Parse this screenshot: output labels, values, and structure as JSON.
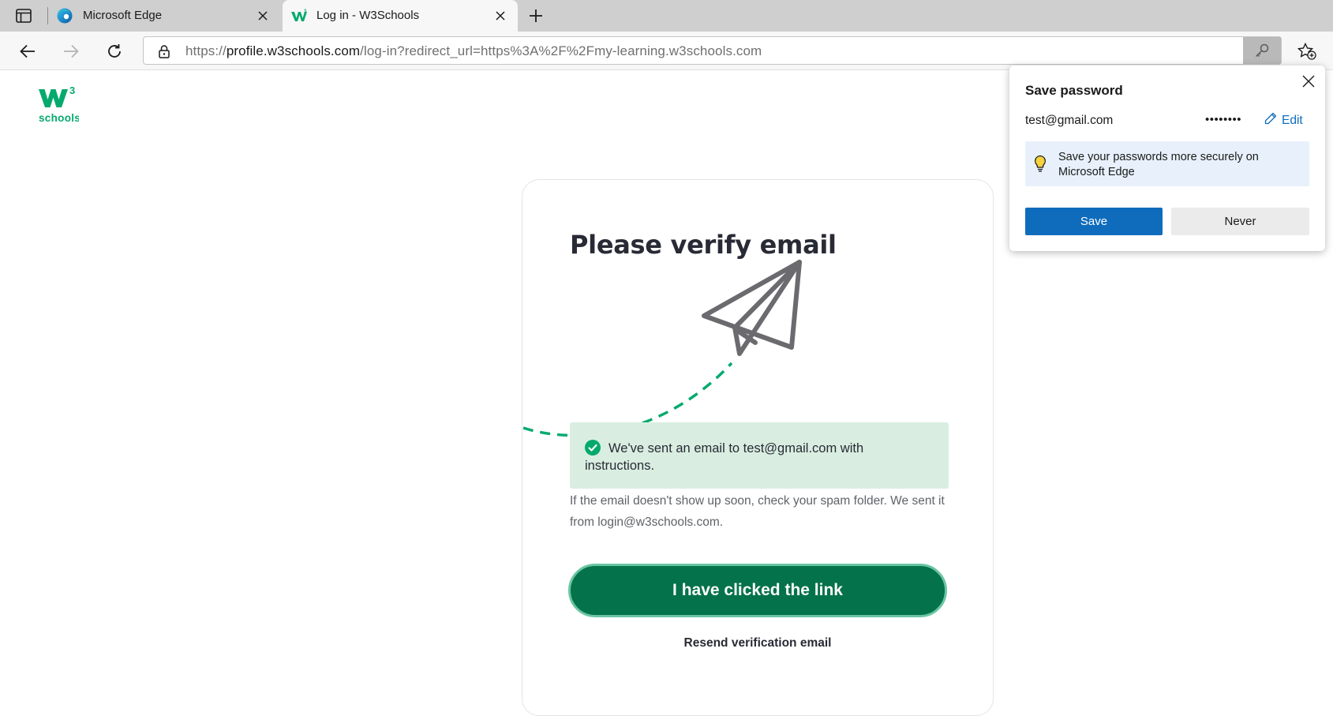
{
  "browser": {
    "tabs": [
      {
        "title": "Microsoft Edge",
        "icon": "edge-logo-icon",
        "active": false
      },
      {
        "title": "Log in - W3Schools",
        "icon": "w3schools-favicon-icon",
        "active": true
      }
    ],
    "url": {
      "scheme": "https://",
      "host": "profile.w3schools.com",
      "path": "/log-in?redirect_url=https%3A%2F%2Fmy-learning.w3schools.com"
    }
  },
  "page": {
    "logo": {
      "mark": "W",
      "superscript": "3",
      "wordmark": "schools"
    },
    "heading": "Please verify email",
    "alert_text": "We've sent an email to test@gmail.com with instructions.",
    "note": "If the email doesn't show up soon, check your spam folder. We sent it from login@w3schools.com.",
    "primary_button": "I have clicked the link",
    "resend_link": "Resend verification email",
    "colors": {
      "brand_green": "#04aa6d",
      "button_green": "#04724a",
      "alert_bg": "#d9eee1"
    }
  },
  "save_password_popup": {
    "title": "Save password",
    "username": "test@gmail.com",
    "password_mask": "••••••••",
    "edit_label": "Edit",
    "info_text": "Save your passwords more securely on Microsoft Edge",
    "save_label": "Save",
    "never_label": "Never",
    "colors": {
      "accent": "#0f6cbd",
      "info_bg": "#e8f1fb"
    }
  }
}
